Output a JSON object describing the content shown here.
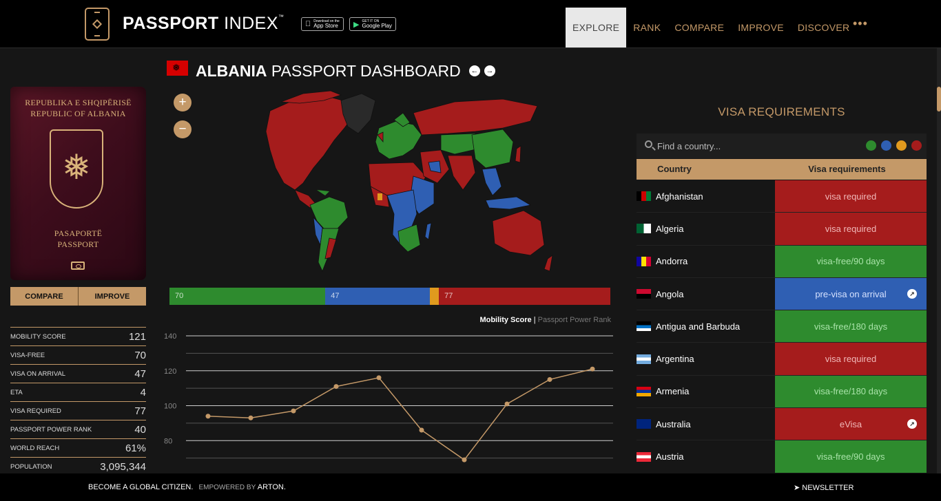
{
  "header": {
    "logo_bold": "PASSPORT",
    "logo_light": "INDEX",
    "logo_tm": "™",
    "app_store": {
      "top": "Download on the",
      "main": "App Store"
    },
    "google_play": {
      "top": "GET IT ON",
      "main": "Google Play"
    },
    "nav": [
      "EXPLORE",
      "RANK",
      "COMPARE",
      "IMPROVE",
      "DISCOVER"
    ],
    "more": "•••"
  },
  "passport": {
    "lines": [
      "REPUBLIKA E SHQIPËRISË",
      "REPUBLIC OF ALBANIA",
      "PASAPORTË",
      "PASSPORT"
    ],
    "compare_label": "COMPARE",
    "improve_label": "IMPROVE"
  },
  "stats": [
    {
      "label": "MOBILITY SCORE",
      "value": "121"
    },
    {
      "label": "VISA-FREE",
      "value": "70"
    },
    {
      "label": "VISA ON ARRIVAL",
      "value": "47"
    },
    {
      "label": "ETA",
      "value": "4"
    },
    {
      "label": "VISA REQUIRED",
      "value": "77"
    },
    {
      "label": "PASSPORT POWER RANK",
      "value": "40"
    },
    {
      "label": "WORLD REACH",
      "value": "61%"
    },
    {
      "label": "POPULATION",
      "value": "3,095,344"
    }
  ],
  "dashboard": {
    "country": "ALBANIA",
    "title_rest": "PASSPORT DASHBOARD",
    "zoom_in": "+",
    "zoom_out": "−"
  },
  "distribution": [
    {
      "label": "70",
      "value": 70,
      "color": "#2e8b2e"
    },
    {
      "label": "47",
      "value": 47,
      "color": "#2f5fb3"
    },
    {
      "label": "",
      "value": 4,
      "color": "#e09a1e"
    },
    {
      "label": "77",
      "value": 77,
      "color": "#a51c1c"
    }
  ],
  "chart_legend": {
    "active": "Mobility Score",
    "separator": "|",
    "inactive": "Passport Power Rank"
  },
  "chart_data": {
    "type": "line",
    "series": [
      {
        "name": "Mobility Score",
        "values": [
          94,
          93,
          97,
          111,
          116,
          86,
          69,
          101,
          115,
          121
        ]
      }
    ],
    "yticks": [
      "140",
      "120",
      "100",
      "80"
    ],
    "ylim": [
      60,
      140
    ],
    "grid": true
  },
  "visa_panel": {
    "title": "VISA REQUIREMENTS",
    "search_placeholder": "Find a country...",
    "filters": [
      "#2e8b2e",
      "#2f5fb3",
      "#e09a1e",
      "#a51c1c"
    ],
    "col_country": "Country",
    "col_requirement": "Visa requirements",
    "rows": [
      {
        "country": "Afghanistan",
        "req": "visa required",
        "status": "red",
        "icon": false
      },
      {
        "country": "Algeria",
        "req": "visa required",
        "status": "red",
        "icon": false
      },
      {
        "country": "Andorra",
        "req": "visa-free/90 days",
        "status": "green",
        "icon": false
      },
      {
        "country": "Angola",
        "req": "pre-visa on arrival",
        "status": "blue",
        "icon": true
      },
      {
        "country": "Antigua and Barbuda",
        "req": "visa-free/180 days",
        "status": "green",
        "icon": false
      },
      {
        "country": "Argentina",
        "req": "visa required",
        "status": "red",
        "icon": false
      },
      {
        "country": "Armenia",
        "req": "visa-free/180 days",
        "status": "green",
        "icon": false
      },
      {
        "country": "Australia",
        "req": "eVisa",
        "status": "red",
        "icon": true
      },
      {
        "country": "Austria",
        "req": "visa-free/90 days",
        "status": "green",
        "icon": false
      }
    ]
  },
  "footer": {
    "tagline": "BECOME A GLOBAL CITIZEN.",
    "empowered": "EMPOWERED BY",
    "brand": "ARTON.",
    "newsletter": "NEWSLETTER"
  }
}
